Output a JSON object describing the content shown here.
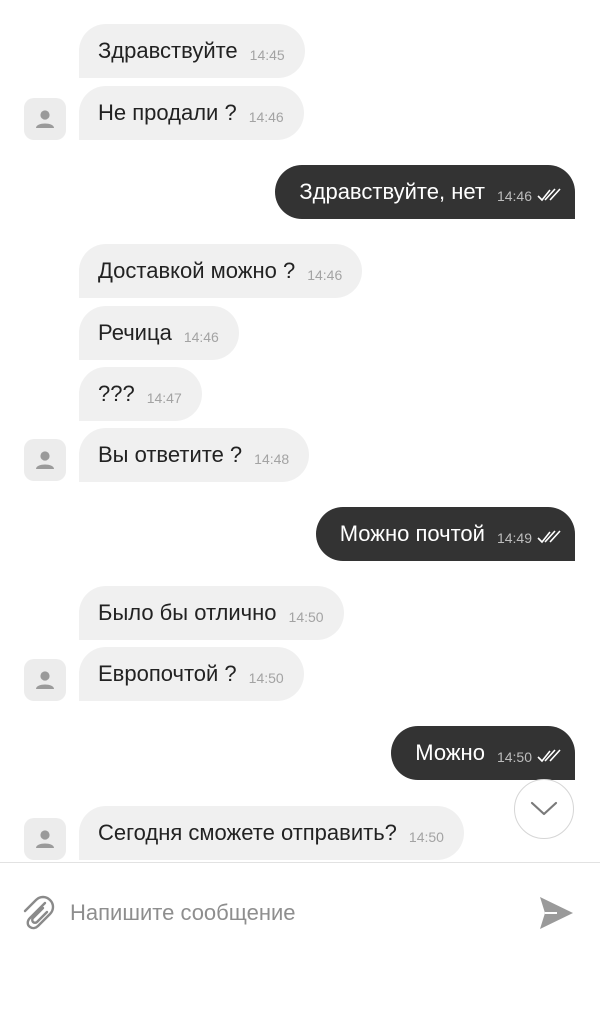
{
  "messages": [
    {
      "dir": "in",
      "text": "Здравствуйте",
      "time": "14:45"
    },
    {
      "dir": "in",
      "text": "Не продали ?",
      "time": "14:46"
    },
    {
      "dir": "out",
      "text": "Здравствуйте, нет",
      "time": "14:46"
    },
    {
      "dir": "in",
      "text": "Доставкой можно ?",
      "time": "14:46"
    },
    {
      "dir": "in",
      "text": "Речица",
      "time": "14:46"
    },
    {
      "dir": "in",
      "text": "???",
      "time": "14:47"
    },
    {
      "dir": "in",
      "text": "Вы ответите ?",
      "time": "14:48"
    },
    {
      "dir": "out",
      "text": "Можно почтой",
      "time": "14:49"
    },
    {
      "dir": "in",
      "text": "Было бы отлично",
      "time": "14:50"
    },
    {
      "dir": "in",
      "text": "Европочтой ?",
      "time": "14:50"
    },
    {
      "dir": "out",
      "text": "Можно",
      "time": "14:50"
    },
    {
      "dir": "in",
      "text": "Сегодня сможете отправить?",
      "time": "14:50"
    }
  ],
  "composer": {
    "placeholder": "Напишите сообщение"
  },
  "icons": {
    "attach": "paperclip-icon",
    "send": "send-icon",
    "scroll_down": "chevron-down-icon",
    "avatar": "user-icon",
    "read": "double-check-icon"
  },
  "colors": {
    "incoming_bubble": "#f0f0f0",
    "outgoing_bubble": "#333333",
    "timestamp": "#a3a3a3"
  }
}
